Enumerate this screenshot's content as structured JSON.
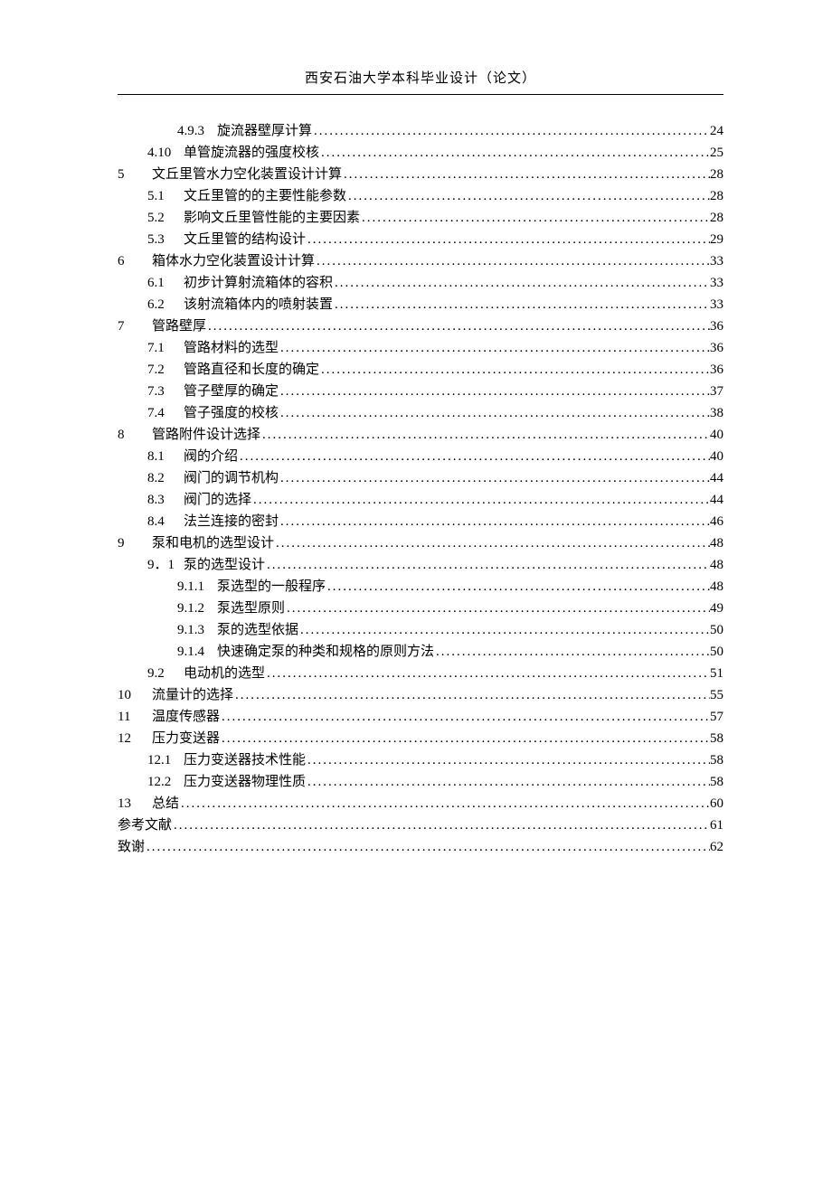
{
  "header_title": "西安石油大学本科毕业设计（论文）",
  "toc_entries": [
    {
      "indent": 2,
      "num": "4.9.3",
      "title": "旋流器壁厚计算",
      "page": "24"
    },
    {
      "indent": 1,
      "num": "4.10",
      "title": "单管旋流器的强度校核",
      "page": "25"
    },
    {
      "indent": 0,
      "num": "5",
      "title": "文丘里管水力空化装置设计计算",
      "page": "28"
    },
    {
      "indent": 1,
      "num": "5.1",
      "title": "文丘里管的的主要性能参数",
      "page": "28"
    },
    {
      "indent": 1,
      "num": "5.2",
      "title": "影响文丘里管性能的主要因素",
      "page": "28"
    },
    {
      "indent": 1,
      "num": "5.3",
      "title": "文丘里管的结构设计",
      "page": "29"
    },
    {
      "indent": 0,
      "num": "6",
      "title": "箱体水力空化装置设计计算",
      "page": "33"
    },
    {
      "indent": 1,
      "num": "6.1",
      "title": "初步计算射流箱体的容积",
      "page": "33"
    },
    {
      "indent": 1,
      "num": "6.2",
      "title": "该射流箱体内的喷射装置",
      "page": "33"
    },
    {
      "indent": 0,
      "num": "7",
      "title": "管路壁厚",
      "page": "36"
    },
    {
      "indent": 1,
      "num": "7.1",
      "title": "管路材料的选型",
      "page": "36"
    },
    {
      "indent": 1,
      "num": "7.2",
      "title": "管路直径和长度的确定",
      "page": "36"
    },
    {
      "indent": 1,
      "num": "7.3",
      "title": "管子壁厚的确定",
      "page": "37"
    },
    {
      "indent": 1,
      "num": "7.4",
      "title": "管子强度的校核",
      "page": "38"
    },
    {
      "indent": 0,
      "num": "8",
      "title": "管路附件设计选择",
      "page": "40"
    },
    {
      "indent": 1,
      "num": "8.1",
      "title": "阀的介绍",
      "page": "40"
    },
    {
      "indent": 1,
      "num": "8.2",
      "title": "阀门的调节机构",
      "page": "44"
    },
    {
      "indent": 1,
      "num": "8.3",
      "title": "阀门的选择",
      "page": "44"
    },
    {
      "indent": 1,
      "num": "8.4",
      "title": "法兰连接的密封",
      "page": "46"
    },
    {
      "indent": 0,
      "num": "9",
      "title": "泵和电机的选型设计",
      "page": "48"
    },
    {
      "indent": 1,
      "num": "9．1",
      "title": "泵的选型设计",
      "page": "48"
    },
    {
      "indent": 2,
      "num": "9.1.1",
      "title": "泵选型的一般程序",
      "page": "48"
    },
    {
      "indent": 2,
      "num": "9.1.2",
      "title": "泵选型原则",
      "page": "49"
    },
    {
      "indent": 2,
      "num": "9.1.3",
      "title": "泵的选型依据",
      "page": "50"
    },
    {
      "indent": 2,
      "num": "9.1.4",
      "title": "快速确定泵的种类和规格的原则方法",
      "page": "50"
    },
    {
      "indent": 1,
      "num": "9.2",
      "title": "电动机的选型",
      "page": "51"
    },
    {
      "indent": 0,
      "num": "10",
      "title": "流量计的选择",
      "page": "55"
    },
    {
      "indent": 0,
      "num": "11",
      "title": "温度传感器",
      "page": "57"
    },
    {
      "indent": 0,
      "num": "12",
      "title": "压力变送器",
      "page": "58"
    },
    {
      "indent": 1,
      "num": "12.1",
      "title": "压力变送器技术性能",
      "page": "58"
    },
    {
      "indent": 1,
      "num": "12.2",
      "title": "压力变送器物理性质",
      "page": "58"
    },
    {
      "indent": 0,
      "num": "13",
      "title": "总结",
      "page": "60"
    },
    {
      "indent": 0,
      "num": "",
      "title": "参考文献",
      "page": "61"
    },
    {
      "indent": 0,
      "num": "",
      "title": "致谢",
      "page": "62"
    }
  ]
}
